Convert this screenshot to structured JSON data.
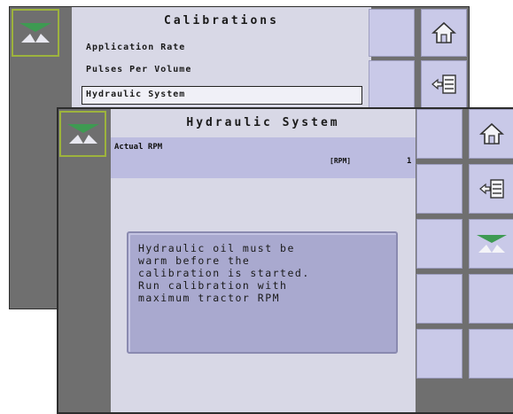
{
  "back_screen": {
    "title": "Calibrations",
    "menu_items": [
      "Application Rate",
      "Pulses Per Volume",
      "Hydraulic System"
    ],
    "selected_item": "Hydraulic System",
    "icons": [
      "spreader-icon",
      "home-icon",
      "exit-menu-icon"
    ]
  },
  "front_screen": {
    "title": "Hydraulic System",
    "field": {
      "label": "Actual RPM",
      "unit": "[RPM]",
      "value": "1"
    },
    "message": "Hydraulic oil must be\nwarm before the\ncalibration is started.\nRun calibration with\nmaximum tractor RPM",
    "icons": [
      "spreader-icon",
      "home-icon",
      "exit-menu-icon",
      "spreader-icon"
    ]
  },
  "colors": {
    "panel_bg": "#d8d8e6",
    "button_bg": "#c9c9e8",
    "sidebar_bg": "#6f6f6f",
    "tile_border": "#9db33d",
    "spreader_green": "#3e9a52"
  }
}
